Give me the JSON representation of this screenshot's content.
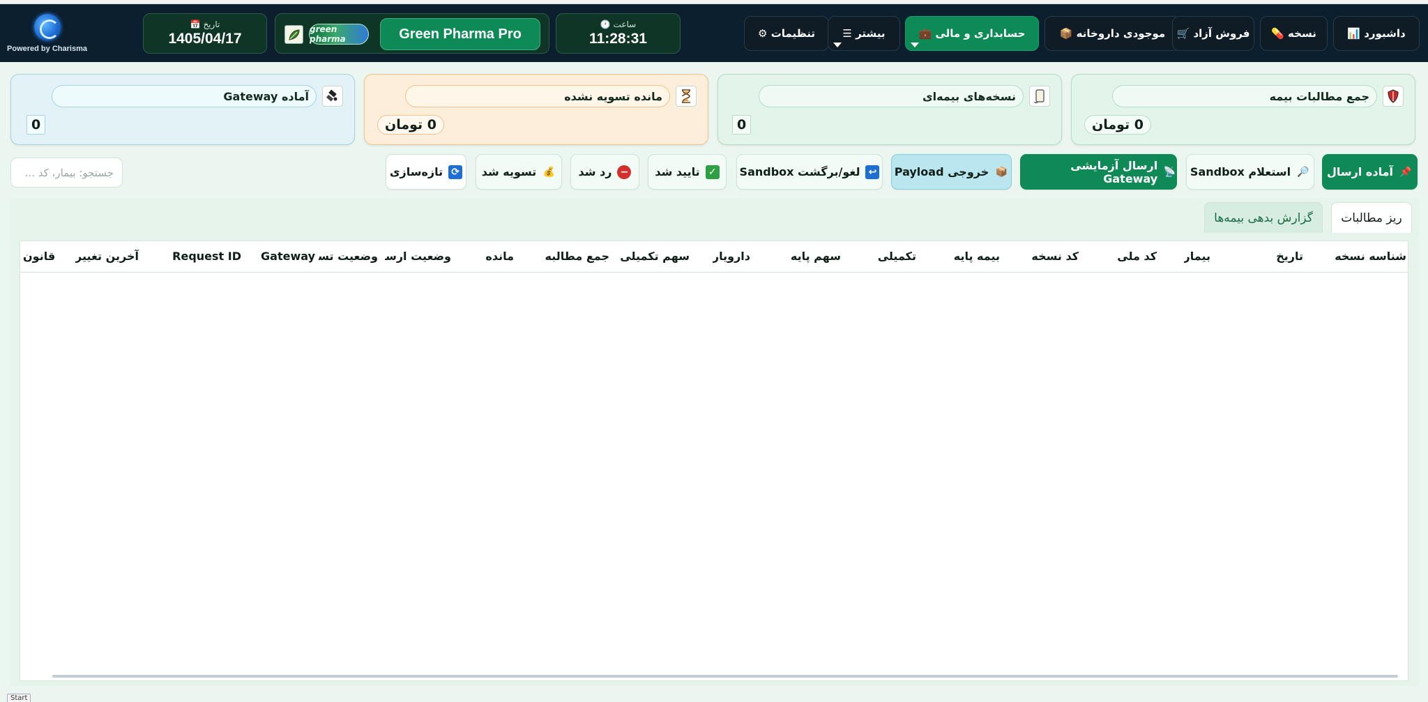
{
  "brand": {
    "powered_by": "Powered by Charisma"
  },
  "header": {
    "date_label": "📅 تاریخ",
    "date_value": "1405/04/17",
    "app_name": "Green Pharma Pro",
    "green_logo_text": "green pharma",
    "clock_label": "🕐 ساعت",
    "clock_value": "11:28:31"
  },
  "nav": {
    "settings": "⚙ تنظیمات",
    "more": "☰ بیشتر",
    "accounting": "💼 حسابداری و مالی",
    "inventory": "📦 موجودی داروخانه",
    "free_sale": "🛒 فروش آزاد",
    "prescription": "💊 نسخه",
    "dashboard": "📊 داشبورد"
  },
  "cards": {
    "insurance_total": {
      "title": "جمع مطالبات بیمه",
      "value": "0 تومان",
      "icon": "shield-icon"
    },
    "insured_rx": {
      "title": "نسخه‌های بیمه‌ای",
      "value": "0",
      "icon": "scroll-icon"
    },
    "unsettled": {
      "title": "مانده تسویه نشده",
      "value": "0 تومان",
      "icon": "hourglass-icon"
    },
    "gateway_ready": {
      "title": "آماده Gateway",
      "value": "0",
      "icon": "satellite-icon"
    }
  },
  "actions": {
    "ready_to_send": "آماده ارسال",
    "sandbox_inquiry": "استعلام Sandbox",
    "gateway_test_send": "ارسال آزمایشی Gateway",
    "payload_export": "خروجی Payload",
    "sandbox_cancel": "لغو/برگشت Sandbox",
    "approved": "تایید شد",
    "rejected": "رد شد",
    "settled": "تسویه شد",
    "refresh": "تازه‌سازی"
  },
  "search": {
    "placeholder": "جستجو: بیمار، کد ..."
  },
  "tabs": {
    "claims_detail": "ریز مطالبات",
    "debt_report": "گزارش بدهی بیمه‌ها"
  },
  "table": {
    "columns": {
      "rx_id": "شناسه نسخه",
      "date": "تاریخ",
      "patient": "بیمار",
      "national_code": "کد ملی",
      "rx_code": "کد نسخه",
      "base_insurance": "بیمه پایه",
      "supplementary": "تکمیلی",
      "base_share": "سهم پایه",
      "pharmacist": "دارویار",
      "supp_share": "سهم تکمیلی",
      "claim_total": "جمع مطالبه",
      "remaining": "مانده",
      "send_status": "وضعیت ارسال",
      "settle_status": "وضعیت تسویه",
      "gateway": "Gateway",
      "request_id": "Request ID",
      "last_change": "آخرین تغییر",
      "law": "قانون"
    }
  },
  "footer": {
    "start": "Start"
  },
  "colors": {
    "header_bg": "#0b1f2f",
    "accent_green": "#0f8a57",
    "panel_bg": "#eaf6ef"
  }
}
